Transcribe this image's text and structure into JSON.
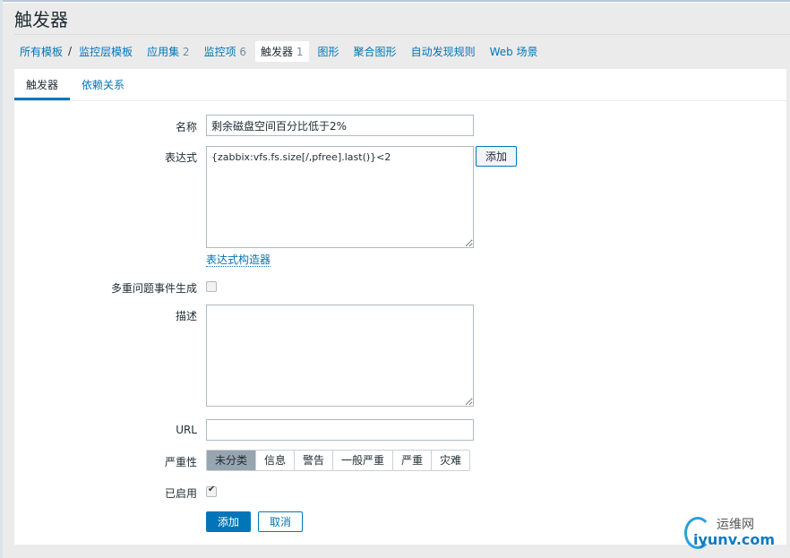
{
  "header": {
    "title": "触发器"
  },
  "nav": {
    "all_templates": "所有模板",
    "separator": "/",
    "template": "监控层模板",
    "items": [
      {
        "label": "应用集",
        "count": "2"
      },
      {
        "label": "监控项",
        "count": "6"
      },
      {
        "label": "触发器",
        "count": "1"
      },
      {
        "label": "图形"
      },
      {
        "label": "聚合图形"
      },
      {
        "label": "自动发现规则"
      },
      {
        "label": "Web 场景"
      }
    ]
  },
  "tabs": [
    {
      "label": "触发器"
    },
    {
      "label": "依赖关系"
    }
  ],
  "form": {
    "name_label": "名称",
    "name_value": "剩余磁盘空间百分比低于2%",
    "expr_label": "表达式",
    "expr_value": "{zabbix:vfs.fs.size[/,pfree].last()}<2",
    "expr_add": "添加",
    "expr_builder": "表达式构造器",
    "multi_label": "多重问题事件生成",
    "multi_checked": false,
    "desc_label": "描述",
    "desc_value": "",
    "url_label": "URL",
    "url_value": "",
    "severity_label": "严重性",
    "severity_options": [
      "未分类",
      "信息",
      "警告",
      "一般严重",
      "严重",
      "灾难"
    ],
    "severity_selected": "未分类",
    "enabled_label": "已启用",
    "enabled_checked": true,
    "submit": "添加",
    "cancel": "取消"
  },
  "watermark": {
    "line1": "运维网",
    "line2": "iyunv.com"
  },
  "colors": {
    "accent": "#0275b8",
    "selected_severity": "#97a5b0"
  }
}
